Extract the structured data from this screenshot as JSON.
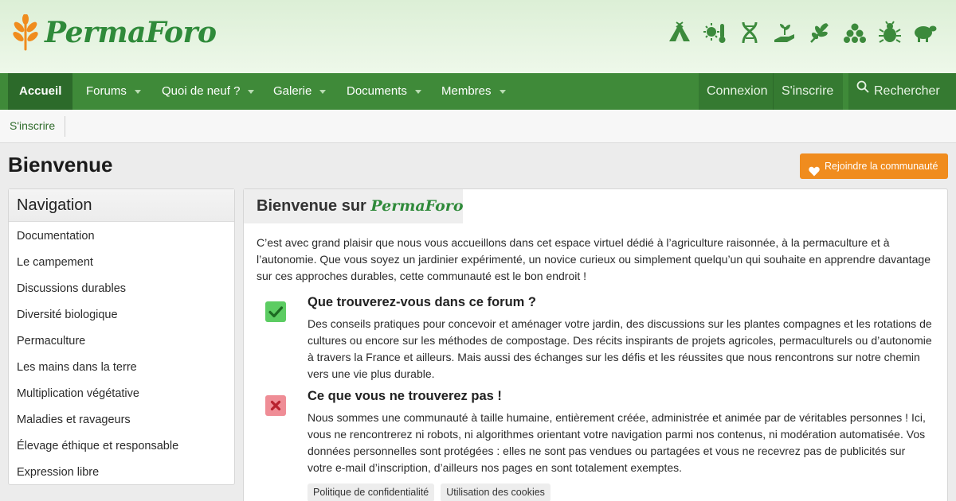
{
  "brand": {
    "name": "PermaForo"
  },
  "theme_icons": [
    "tent-icon",
    "sun-thermometer-icon",
    "dna-icon",
    "hand-seedling-icon",
    "leaf-branch-icon",
    "seeds-icon",
    "bug-icon",
    "sheep-icon"
  ],
  "nav": {
    "home": "Accueil",
    "items": [
      {
        "label": "Forums"
      },
      {
        "label": "Quoi de neuf ?"
      },
      {
        "label": "Galerie"
      },
      {
        "label": "Documents"
      },
      {
        "label": "Membres"
      }
    ],
    "login": "Connexion",
    "register": "S'inscrire",
    "search": "Rechercher"
  },
  "subnav": {
    "register": "S'inscrire"
  },
  "page": {
    "title": "Bienvenue",
    "join_label": "Rejoindre la communauté"
  },
  "sidebar": {
    "title": "Navigation",
    "items": [
      "Documentation",
      "Le campement",
      "Discussions durables",
      "Diversité biologique",
      "Permaculture",
      "Les mains dans la terre",
      "Multiplication végétative",
      "Maladies et ravageurs",
      "Élevage éthique et responsable",
      "Expression libre"
    ]
  },
  "main": {
    "title_prefix": "Bienvenue sur",
    "title_brand": "PermaForo",
    "intro": "C’est avec grand plaisir que nous vous accueillons dans cet espace virtuel dédié à l’agriculture raisonnée, à la permaculture et à l’autonomie. Que vous soyez un jardinier expérimenté, un novice curieux ou simplement quelqu’un qui souhaite en apprendre davantage sur ces approches durables, cette communauté est le bon endroit !",
    "features": [
      {
        "title": "Que trouverez-vous dans ce forum ?",
        "text": "Des conseils pratiques pour concevoir et aménager votre jardin, des discussions sur les plantes compagnes et les rotations de cultures ou encore sur les méthodes de compostage. Des récits inspirants de projets agricoles, permaculturels ou d’autonomie à travers la France et ailleurs. Mais aussi des échanges sur les défis et les réussites que nous rencontrons sur notre chemin vers une vie plus durable."
      },
      {
        "title": "Ce que vous ne trouverez pas !",
        "text": "Nous sommes une communauté à taille humaine, entièrement créée, administrée et animée par de véritables personnes ! Ici, vous ne rencontrerez ni robots, ni algorithmes orientant votre navigation parmi nos contenus, ni modération automatisée. Vos données personnelles sont protégées : elles ne sont pas vendues ou partagées et vous ne recevrez pas de publicités sur votre e-mail d’inscription, d’ailleurs nos pages en sont totalement exemptes."
      }
    ],
    "tags": [
      "Politique de confidentialité",
      "Utilisation des cookies"
    ]
  },
  "colors": {
    "brand_green": "#2f8a3a",
    "nav_green": "#3f8a39",
    "nav_active": "#2c6a2a",
    "accent_orange": "#f08c1e",
    "icon_green": "#3c8a3c"
  }
}
